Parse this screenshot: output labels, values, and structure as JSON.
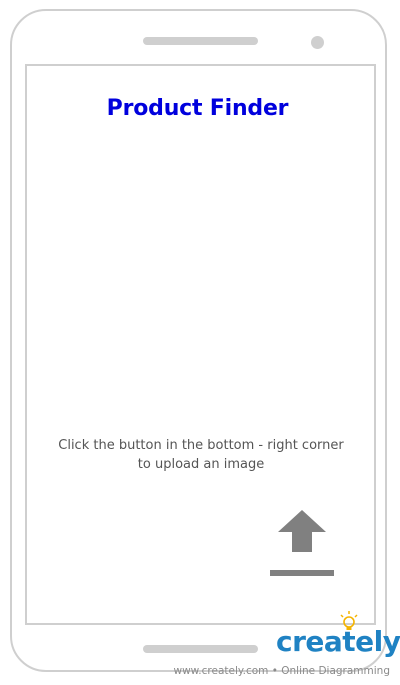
{
  "app": {
    "title": "Product Finder"
  },
  "main": {
    "instructions": "Click the button in the bottom - right corner to upload an image"
  },
  "upload_button": {
    "icon": "upload-icon",
    "color": "#808080"
  },
  "colors": {
    "title": "#0000dd",
    "frame": "#cfcfcf",
    "brand": "#1f82c3",
    "bulb": "#f5b400"
  },
  "watermark": {
    "logo_text": "creately",
    "footer": "www.creately.com • Online Diagramming"
  }
}
